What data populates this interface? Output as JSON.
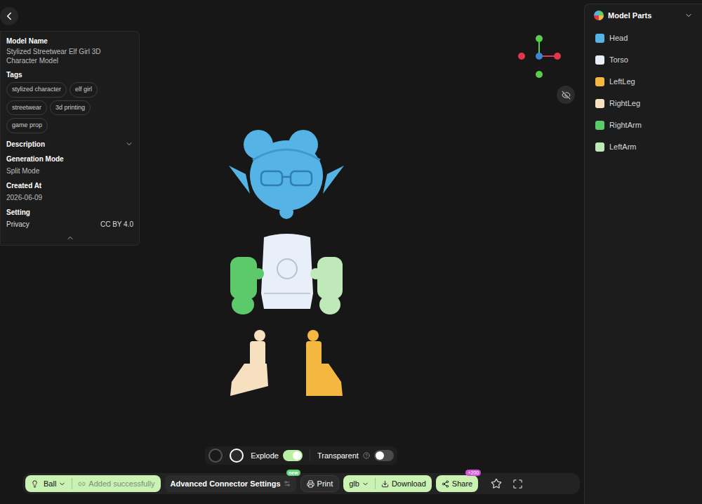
{
  "model_info": {
    "name_label": "Model Name",
    "name": "Stylized Streetwear Elf Girl 3D Character Model",
    "tags_label": "Tags",
    "tags": [
      "stylized character",
      "elf girl",
      "streetwear",
      "3d printing",
      "game prop"
    ],
    "description_label": "Description",
    "generation_mode_label": "Generation Mode",
    "generation_mode": "Split Mode",
    "created_label": "Created At",
    "created": "2026-06-09",
    "setting_label": "Setting",
    "privacy_label": "Privacy",
    "privacy": "CC BY 4.0"
  },
  "model_parts": {
    "title": "Model Parts",
    "items": [
      {
        "name": "Head",
        "color": "#55b3e6"
      },
      {
        "name": "Torso",
        "color": "#e8eff8"
      },
      {
        "name": "LeftLeg",
        "color": "#f4b73f"
      },
      {
        "name": "RightLeg",
        "color": "#f6e0c0"
      },
      {
        "name": "RightArm",
        "color": "#5cc96a"
      },
      {
        "name": "LeftArm",
        "color": "#bfe9b8"
      }
    ]
  },
  "view_toggles": [
    {
      "label": "Explode",
      "on": true
    },
    {
      "label": "Transparent",
      "on": false
    }
  ],
  "toolbar": {
    "connector": "Ball",
    "status": "Added successfully",
    "advanced": "Advanced Connector Settings",
    "advanced_badge": "new",
    "print": "Print",
    "format": "glb",
    "download": "Download",
    "share": "Share",
    "share_badge": "+200"
  }
}
